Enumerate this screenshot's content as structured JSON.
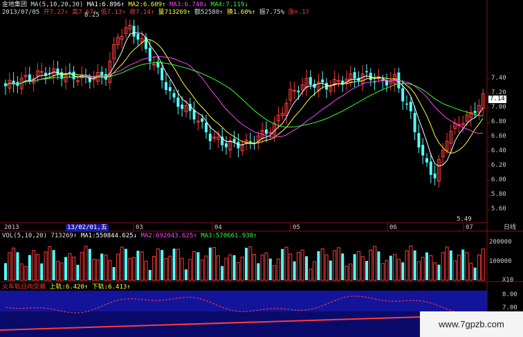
{
  "header": {
    "stock_name": "金地集团",
    "ma_label": "MA(5,10,20,30)",
    "ma1": "MA1:6.896↑",
    "ma2": "MA2:6.609↑",
    "ma3": "MA3:6.748↓",
    "ma4": "MA4:7.119↓",
    "date": "2013/07/05",
    "open": "开7.27↑",
    "high": "高7.67↑",
    "low": "低7.13↑",
    "close": "收7.14↑",
    "volume": "量713269↑",
    "amount": "额52580↑",
    "turnover": "换1.60%↑",
    "amplitude": "振7.75%",
    "change": "涨⊙.17"
  },
  "price_axis": [
    "7.40",
    "7.20",
    "7.00",
    "6.80",
    "6.60",
    "6.40",
    "6.20",
    "6.00",
    "5.80",
    "5.60"
  ],
  "current_price_tag": "7.14",
  "annotations": {
    "high_label": "8.25",
    "low_label": "5.49"
  },
  "time_axis": {
    "start": "2013",
    "cursor": "13/02/01,五",
    "months": [
      "03",
      "04",
      "05",
      "06",
      "07"
    ],
    "period_label": "日线"
  },
  "vol_header": {
    "label": "VOL(5,10,20)",
    "value": "713269↑",
    "ma1": "MA1:550844.625↓",
    "ma2": "MA2:692043.625↑",
    "ma3": "MA3:570661.938↑"
  },
  "vol_axis": [
    "200000",
    "100000"
  ],
  "vol_unit": "X10",
  "indicator": {
    "name": "火车轨日内交易",
    "upper": "上轨:6.420↑",
    "lower": "下轨:6.413↑",
    "axis": [
      "8.00",
      "7.00"
    ]
  },
  "watermark": "www.7gpzb.com",
  "colors": {
    "up": "#ff3b3b",
    "down": "#54ffff",
    "ma1": "#ffffff",
    "ma2": "#ffff33",
    "ma3": "#ff44ff",
    "ma4": "#33ff33",
    "cursor_bg": "#1a1aa8"
  }
}
